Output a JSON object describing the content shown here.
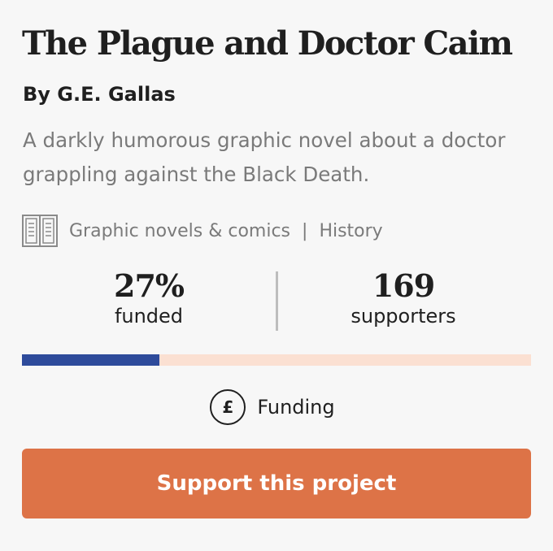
{
  "project": {
    "title": "The Plague and Doctor Caim",
    "author": "By G.E. Gallas",
    "description": "A darkly humorous graphic novel about a doctor grappling against the Black Death."
  },
  "categories": {
    "icon": "book-icon",
    "primary": "Graphic novels & comics",
    "separator": "|",
    "secondary": "History"
  },
  "stats": {
    "funded_value": "27%",
    "funded_label": "funded",
    "supporters_value": "169",
    "supporters_label": "supporters",
    "progress_fraction": 0.27
  },
  "status": {
    "icon": "pound-icon",
    "icon_glyph": "£",
    "label": "Funding"
  },
  "cta": {
    "label": "Support this project"
  },
  "colors": {
    "progress_fill": "#2e4b9b",
    "progress_track": "#fbe0d2",
    "cta_background": "#dd7347"
  }
}
